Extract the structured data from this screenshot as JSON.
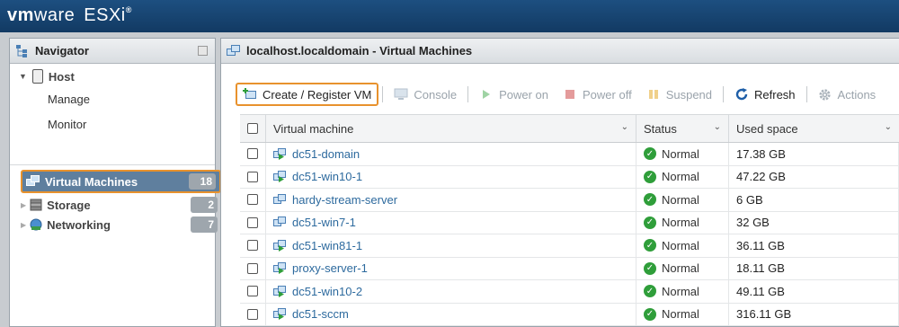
{
  "brand": {
    "vm": "vm",
    "ware": "ware",
    "product": "ESXi",
    "mark": "®"
  },
  "navigator": {
    "title": "Navigator",
    "host": {
      "label": "Host",
      "items": [
        "Manage",
        "Monitor"
      ]
    },
    "items": [
      {
        "label": "Virtual Machines",
        "count": "18",
        "selected": true
      },
      {
        "label": "Storage",
        "count": "2"
      },
      {
        "label": "Networking",
        "count": "7"
      }
    ]
  },
  "main": {
    "title": "localhost.localdomain - Virtual Machines",
    "toolbar": {
      "create": "Create / Register VM",
      "console": "Console",
      "power_on": "Power on",
      "power_off": "Power off",
      "suspend": "Suspend",
      "refresh": "Refresh",
      "actions": "Actions"
    },
    "table": {
      "columns": [
        "Virtual machine",
        "Status",
        "Used space"
      ],
      "rows": [
        {
          "name": "dc51-domain",
          "status": "Normal",
          "used": "17.38 GB",
          "powered": true
        },
        {
          "name": "dc51-win10-1",
          "status": "Normal",
          "used": "47.22 GB",
          "powered": true
        },
        {
          "name": "hardy-stream-server",
          "status": "Normal",
          "used": "6 GB",
          "powered": false
        },
        {
          "name": "dc51-win7-1",
          "status": "Normal",
          "used": "32 GB",
          "powered": false
        },
        {
          "name": "dc51-win81-1",
          "status": "Normal",
          "used": "36.11 GB",
          "powered": true
        },
        {
          "name": "proxy-server-1",
          "status": "Normal",
          "used": "18.11 GB",
          "powered": true
        },
        {
          "name": "dc51-win10-2",
          "status": "Normal",
          "used": "49.11 GB",
          "powered": true
        },
        {
          "name": "dc51-sccm",
          "status": "Normal",
          "used": "316.11 GB",
          "powered": true
        }
      ]
    }
  }
}
